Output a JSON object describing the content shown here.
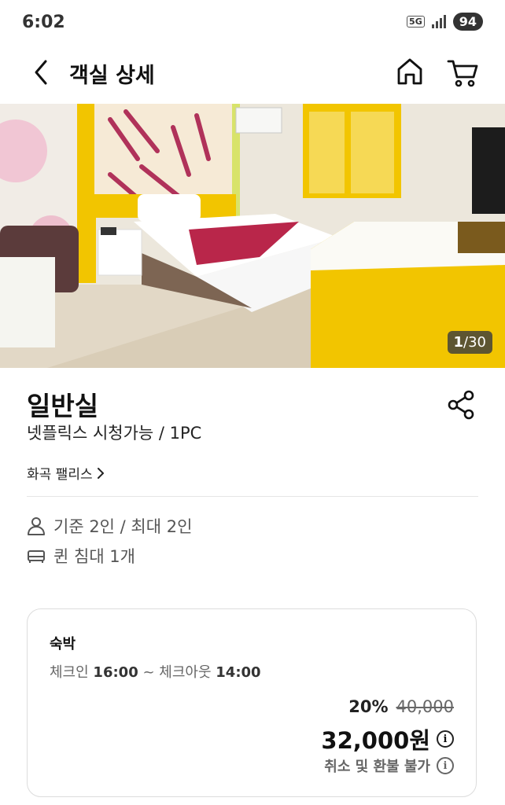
{
  "status_bar": {
    "time": "6:02",
    "network": "5G",
    "battery": "94"
  },
  "header": {
    "title": "객실 상세"
  },
  "photo": {
    "current": "1",
    "total": "/30"
  },
  "room": {
    "name": "일반실",
    "subtitle": "넷플릭스 시청가능 / 1PC",
    "hotel_link": "화곡 팰리스",
    "occupancy": "기준 2인 / 최대 2인",
    "bed": "퀸 침대 1개"
  },
  "booking": {
    "type": "숙박",
    "checkin_label": "체크인",
    "checkin_time": "16:00",
    "separator": "~",
    "checkout_label": "체크아웃",
    "checkout_time": "14:00",
    "discount": "20%",
    "original_price": "40,000",
    "price": "32,000원",
    "refund_policy": "취소 및 환불 불가"
  },
  "colors": {
    "accent_yellow": "#f2c500",
    "text_primary": "#111111",
    "text_secondary": "#666666",
    "border": "#dcdcdc"
  }
}
